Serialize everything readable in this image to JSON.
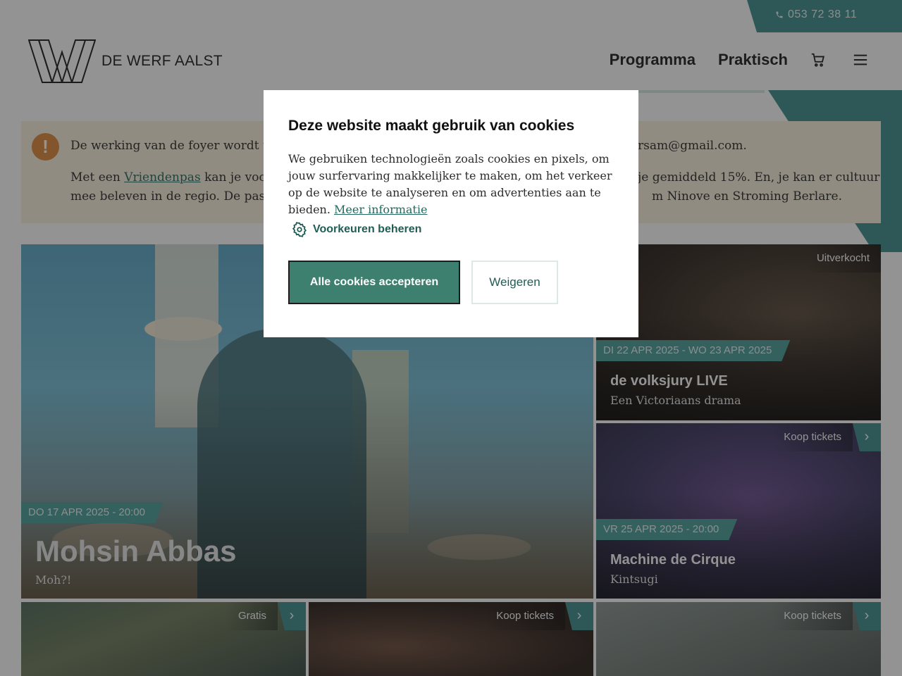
{
  "topbar": {
    "phone": "053 72 38 11",
    "phone_icon": "phone-icon"
  },
  "header": {
    "logo_text": "DE WERF AALST",
    "nav": [
      {
        "label": "Programma"
      },
      {
        "label": "Praktisch"
      }
    ],
    "cart_icon": "cart-icon",
    "menu_icon": "hamburger-menu-icon"
  },
  "notice": {
    "icon": "!",
    "line1_start": "De werking van de foyer wordt tijde",
    "line1_end": "rsam@gmail.com.",
    "line2_start": "Met een ",
    "line2_link": "Vriendenpas",
    "line2_mid": " kan je voorde",
    "line2_end": "je gemiddeld 15%. En, je kan er cultuur",
    "line3_start": "mee beleven in de regio. De pas is i",
    "line3_end": "m Ninove en Stroming Berlare."
  },
  "cards": {
    "main": {
      "date": "DO 17 APR 2025 - 20:00",
      "title": "Mohsin Abbas",
      "subtitle": "Moh?!"
    },
    "volksjury": {
      "badge": "Uitverkocht",
      "date": "DI 22 APR 2025 - WO 23 APR 2025",
      "title": "de volksjury LIVE",
      "subtitle": "Een Victoriaans drama"
    },
    "cirque": {
      "badge": "Koop tickets",
      "arrow": "›",
      "date": "VR 25 APR 2025 - 20:00",
      "title": "Machine de Cirque",
      "subtitle": "Kintsugi"
    },
    "bottom": [
      {
        "badge": "Gratis",
        "arrow": "›"
      },
      {
        "badge": "Koop tickets",
        "arrow": "›"
      },
      {
        "badge": "Koop tickets",
        "arrow": "›"
      }
    ]
  },
  "cookie_modal": {
    "title": "Deze website maakt gebruik van cookies",
    "body": "We gebruiken technologieën zoals cookies en pixels, om jouw surfervaring makkelijker te maken, om het verkeer op de website te analyseren en om advertenties aan te bieden.",
    "more_link": "Meer informatie",
    "prefs_label": "Voorkeuren beheren",
    "accept_label": "Alle cookies accepteren",
    "refuse_label": "Weigeren"
  },
  "colors": {
    "teal": "#3f8f8f",
    "accept": "#3e8070",
    "notice_bg": "#fbf2dc",
    "warning": "#e0883a"
  }
}
